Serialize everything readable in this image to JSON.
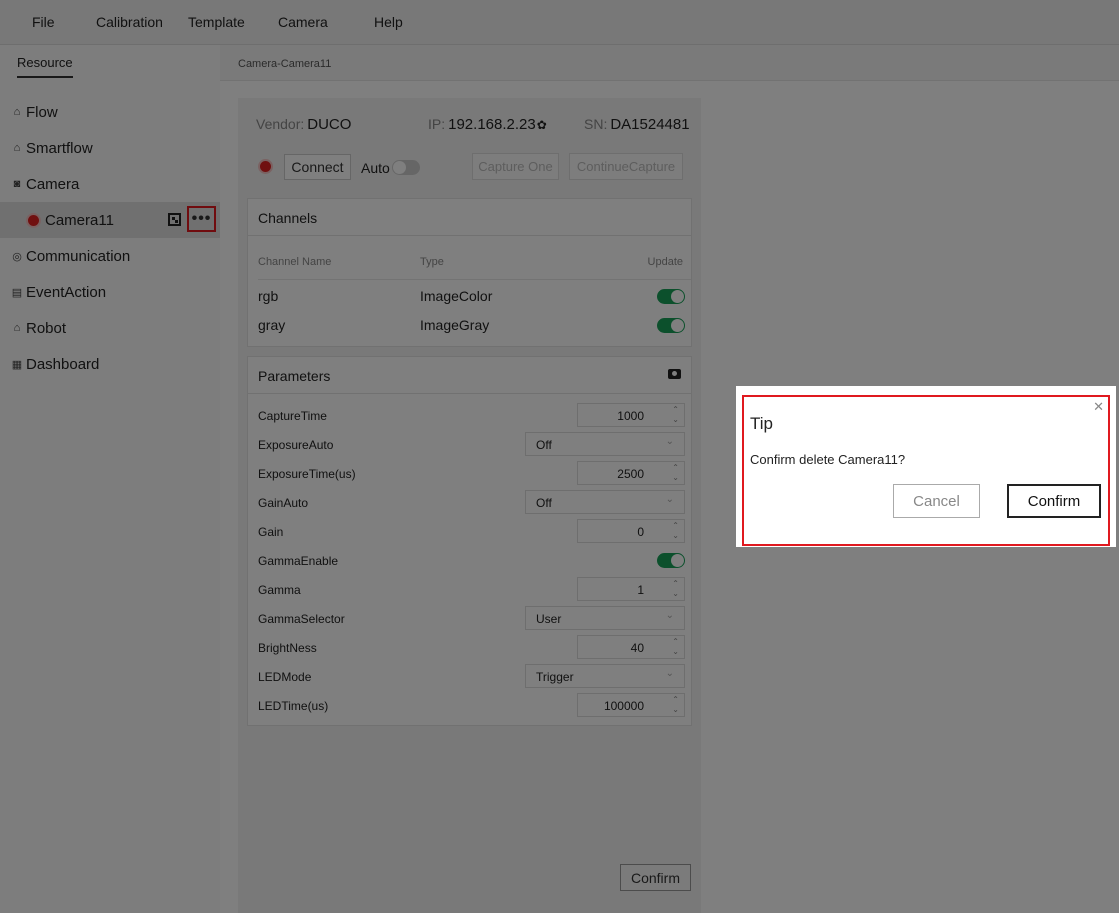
{
  "menu": [
    "File",
    "Calibration",
    "Template",
    "Camera",
    "Help"
  ],
  "sidebar": {
    "tab": "Resource",
    "items": [
      {
        "label": "Flow",
        "icon": "flow-icon",
        "glyph": "⌂"
      },
      {
        "label": "Smartflow",
        "icon": "smartflow-icon",
        "glyph": "⌂"
      },
      {
        "label": "Camera",
        "icon": "camera-icon",
        "glyph": "◙"
      },
      {
        "label": "Camera11",
        "icon": "status-dot-icon",
        "glyph": ""
      },
      {
        "label": "Communication",
        "icon": "communication-icon",
        "glyph": "◎"
      },
      {
        "label": "EventAction",
        "icon": "event-icon",
        "glyph": "▤"
      },
      {
        "label": "Robot",
        "icon": "robot-icon",
        "glyph": "⌂"
      },
      {
        "label": "Dashboard",
        "icon": "dashboard-icon",
        "glyph": "▦"
      }
    ],
    "more_glyph": "•••"
  },
  "breadcrumb": "Camera-Camera11",
  "camera": {
    "vendor_label": "Vendor:",
    "vendor": "DUCO",
    "ip_label": "IP:",
    "ip": "192.168.2.23",
    "ip_icon": "✿",
    "sn_label": "SN:",
    "sn": "DA1524481",
    "connect": "Connect",
    "auto": "Auto",
    "capture_one": "Capture One",
    "continue_capture": "ContinueCapture"
  },
  "channels": {
    "title": "Channels",
    "headers": [
      "Channel Name",
      "Type",
      "Update"
    ],
    "rows": [
      {
        "name": "rgb",
        "type": "ImageColor",
        "update": true
      },
      {
        "name": "gray",
        "type": "ImageGray",
        "update": true
      }
    ]
  },
  "parameters": {
    "title": "Parameters",
    "rows": [
      {
        "label": "CaptureTime",
        "kind": "number",
        "value": "1000"
      },
      {
        "label": "ExposureAuto",
        "kind": "select",
        "value": "Off"
      },
      {
        "label": "ExposureTime(us)",
        "kind": "number",
        "value": "2500"
      },
      {
        "label": "GainAuto",
        "kind": "select",
        "value": "Off"
      },
      {
        "label": "Gain",
        "kind": "number",
        "value": "0"
      },
      {
        "label": "GammaEnable",
        "kind": "toggle",
        "value": true
      },
      {
        "label": "Gamma",
        "kind": "number",
        "value": "1"
      },
      {
        "label": "GammaSelector",
        "kind": "select",
        "value": "User"
      },
      {
        "label": "BrightNess",
        "kind": "number",
        "value": "40"
      },
      {
        "label": "LEDMode",
        "kind": "select",
        "value": "Trigger"
      },
      {
        "label": "LEDTime(us)",
        "kind": "number",
        "value": "100000"
      }
    ]
  },
  "panel_confirm": "Confirm",
  "dialog": {
    "title": "Tip",
    "message": "Confirm delete Camera11?",
    "cancel": "Cancel",
    "confirm": "Confirm",
    "close_glyph": "✕"
  },
  "colors": {
    "status_red": "#e02020",
    "toggle_on": "#18a058",
    "highlight": "#e0191f"
  }
}
